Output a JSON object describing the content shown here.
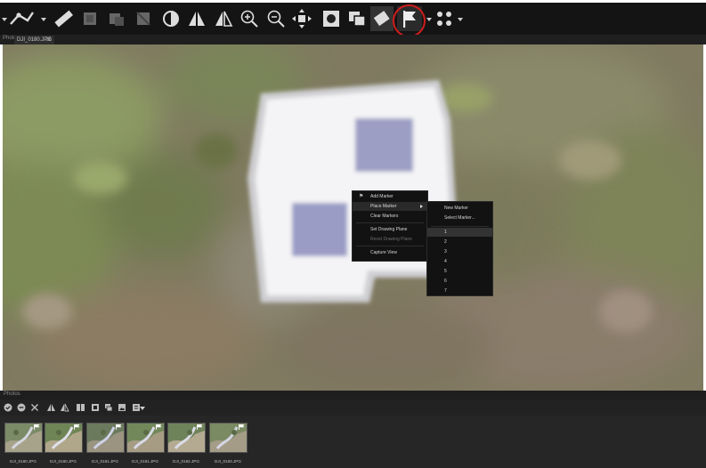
{
  "tab": {
    "prefix": "Photo",
    "name": "DJI_0180.JPG"
  },
  "toolbar": {
    "icons": [
      "polyline-icon",
      "ruler-icon",
      "cube-icon",
      "cube-alt-icon",
      "cube-split-icon",
      "contrast-icon",
      "reflect-icon",
      "reflect-alt-icon",
      "zoom-in-icon",
      "zoom-out-icon",
      "move-icon",
      "mask-icon",
      "stack-icon",
      "eraser-icon",
      "flag-icon",
      "dots-icon"
    ],
    "highlight": "flag-icon",
    "highlight_color": "#d01c1c"
  },
  "context_menu": {
    "items": [
      {
        "label": "Add Marker",
        "icon": "marker-pin-icon"
      },
      {
        "label": "Place Marker",
        "has_submenu": true
      },
      {
        "label": "Clear Markers"
      },
      {
        "label": "Set Drawing Plane"
      },
      {
        "label": "Reset Drawing Plane",
        "disabled": true
      },
      {
        "label": "Capture View"
      }
    ]
  },
  "submenu": {
    "actions": [
      "New Marker",
      "Select Marker..."
    ],
    "markers": [
      "1",
      "2",
      "3",
      "4",
      "5",
      "6",
      "7"
    ]
  },
  "photos": {
    "label": "Photos",
    "files": [
      "DJI_0180.JPG",
      "DJI_0180.JPG",
      "DJI_0181.JPG",
      "DJI_0181.JPG",
      "DJI_0182.JPG",
      "DJI_0183.JPG"
    ]
  }
}
